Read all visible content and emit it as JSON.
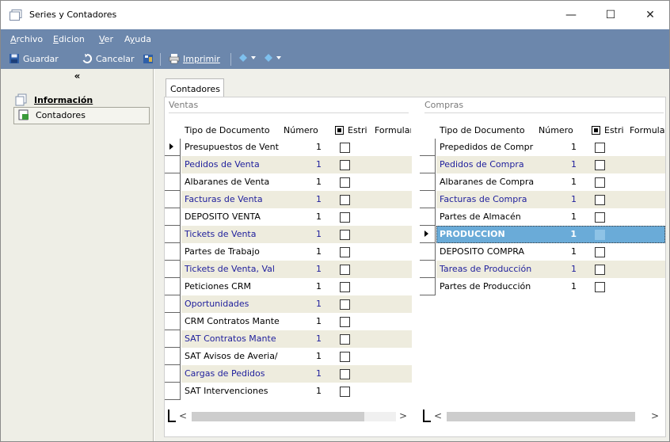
{
  "window": {
    "title": "Series y Contadores",
    "minimize": "—",
    "maximize": "☐",
    "close": "✕"
  },
  "menu": [
    {
      "label": "Archivo",
      "mnemonic_index": 0
    },
    {
      "label": "Edicion",
      "mnemonic_index": 0
    },
    {
      "label": "Ver",
      "mnemonic_index": 0
    },
    {
      "label": "Ayuda",
      "mnemonic_index": 1
    }
  ],
  "toolbar": {
    "save_label": "Guardar",
    "cancel_label": "Cancelar",
    "print_label": "Imprimir"
  },
  "sidebar": {
    "collapse": "«",
    "items": [
      {
        "label": "Información"
      },
      {
        "label": "Contadores"
      }
    ]
  },
  "tabs": [
    {
      "label": "Contadores"
    }
  ],
  "ventas": {
    "group_label": "Ventas",
    "columns": [
      "Tipo de Documento",
      "Número",
      "Estri",
      "Formular"
    ],
    "rows": [
      {
        "tipo": "Presupuestos de Vent",
        "numero": "1"
      },
      {
        "tipo": "Pedidos de Venta",
        "numero": "1"
      },
      {
        "tipo": "Albaranes de Venta",
        "numero": "1"
      },
      {
        "tipo": "Facturas de Venta",
        "numero": "1"
      },
      {
        "tipo": "DEPOSITO VENTA",
        "numero": "1"
      },
      {
        "tipo": "Tickets de Venta",
        "numero": "1"
      },
      {
        "tipo": "Partes de Trabajo",
        "numero": "1"
      },
      {
        "tipo": "Tickets de Venta, Val",
        "numero": "1"
      },
      {
        "tipo": "Peticiones CRM",
        "numero": "1"
      },
      {
        "tipo": "Oportunidades",
        "numero": "1"
      },
      {
        "tipo": "CRM Contratos Mante",
        "numero": "1"
      },
      {
        "tipo": "SAT Contratos Mante",
        "numero": "1"
      },
      {
        "tipo": "SAT Avisos de Averia/",
        "numero": "1"
      },
      {
        "tipo": "Cargas de Pedidos",
        "numero": "1"
      },
      {
        "tipo": "SAT Intervenciones",
        "numero": "1"
      }
    ]
  },
  "compras": {
    "group_label": "Compras",
    "columns": [
      "Tipo de Documento",
      "Número",
      "Estri",
      "Formular"
    ],
    "rows": [
      {
        "tipo": "Prepedidos de Compr",
        "numero": "1"
      },
      {
        "tipo": "Pedidos de Compra",
        "numero": "1"
      },
      {
        "tipo": "Albaranes de Compra",
        "numero": "1"
      },
      {
        "tipo": "Facturas de Compra",
        "numero": "1"
      },
      {
        "tipo": "Partes de Almacén",
        "numero": "1"
      },
      {
        "tipo": "PRODUCCION",
        "numero": "1"
      },
      {
        "tipo": "DEPOSITO COMPRA",
        "numero": "1"
      },
      {
        "tipo": "Tareas de Producción",
        "numero": "1"
      },
      {
        "tipo": "Partes de Producción",
        "numero": "1"
      }
    ]
  },
  "scroll": {
    "left": "<",
    "right": ">"
  },
  "colors": {
    "menubar": "#6c87ac",
    "alt_row": "#eeecde",
    "alt_text": "#1e1e9c",
    "selected_row": "#6aabd8"
  }
}
